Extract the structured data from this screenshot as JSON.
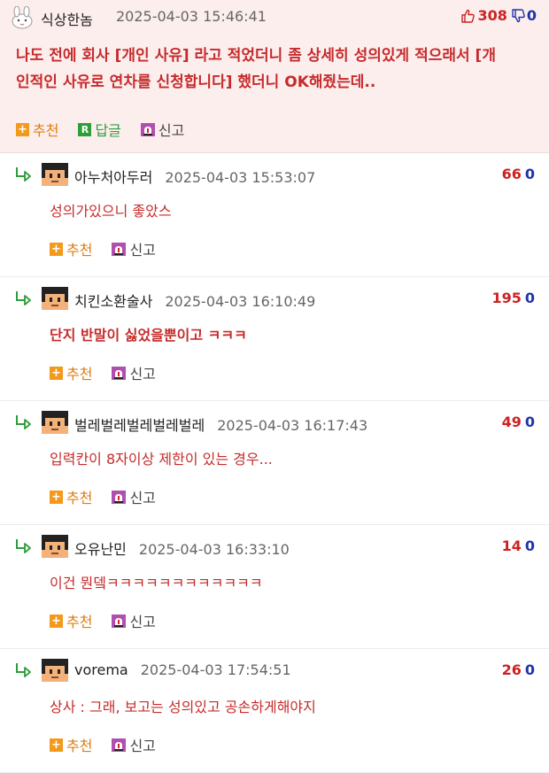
{
  "top_comment": {
    "username": "식상한놈",
    "date": "2025-04-03 15:46:41",
    "upvotes": "308",
    "downvotes": "0",
    "text_line1": "나도 전에 회사 [개인 사유] 라고 적었더니 좀 상세히 성의있게 적으래서 [개",
    "text_line2": "인적인 사유로 연차를 신청합니다] 했더니 OK해줬는데..",
    "actions": {
      "recommend": "추천",
      "reply": "답글",
      "report": "신고"
    }
  },
  "replies": [
    {
      "username": "아누처아두러",
      "date": "2025-04-03 15:53:07",
      "up": "66",
      "down": "0",
      "text": "성의가있으니 좋았스",
      "bold": false
    },
    {
      "username": "치킨소환술사",
      "date": "2025-04-03 16:10:49",
      "up": "195",
      "down": "0",
      "text": "단지 반말이 싫었을뿐이고 ㅋㅋㅋ",
      "bold": true
    },
    {
      "username": "벌레벌레벌레벌레벌레",
      "date": "2025-04-03 16:17:43",
      "up": "49",
      "down": "0",
      "text": "입력칸이 8자이상 제한이 있는 경우...",
      "bold": false
    },
    {
      "username": "오유난민",
      "date": "2025-04-03 16:33:10",
      "up": "14",
      "down": "0",
      "text": "이건 뭔뎈ㅋㅋㅋㅋㅋㅋㅋㅋㅋㅋㅋㅋ",
      "bold": false
    },
    {
      "username": "vorema",
      "date": "2025-04-03 17:54:51",
      "up": "26",
      "down": "0",
      "text": "상사 : 그래, 보고는 성의있고 공손하게해야지",
      "bold": false
    }
  ],
  "reply_actions": {
    "recommend": "추천",
    "report": "신고"
  },
  "colors": {
    "accent_red": "#c62b2b",
    "upvote": "#cc2222",
    "downvote": "#2233aa",
    "recommend_orange": "#f39a1c",
    "reply_green": "#2e9e3a",
    "top_bg": "#fdeeee"
  },
  "icons": [
    "bunny-avatar-icon",
    "thumbs-up-icon",
    "thumbs-down-icon",
    "plus-icon",
    "reply-r-icon",
    "siren-icon",
    "reply-arrow-icon",
    "pixel-avatar-icon"
  ]
}
